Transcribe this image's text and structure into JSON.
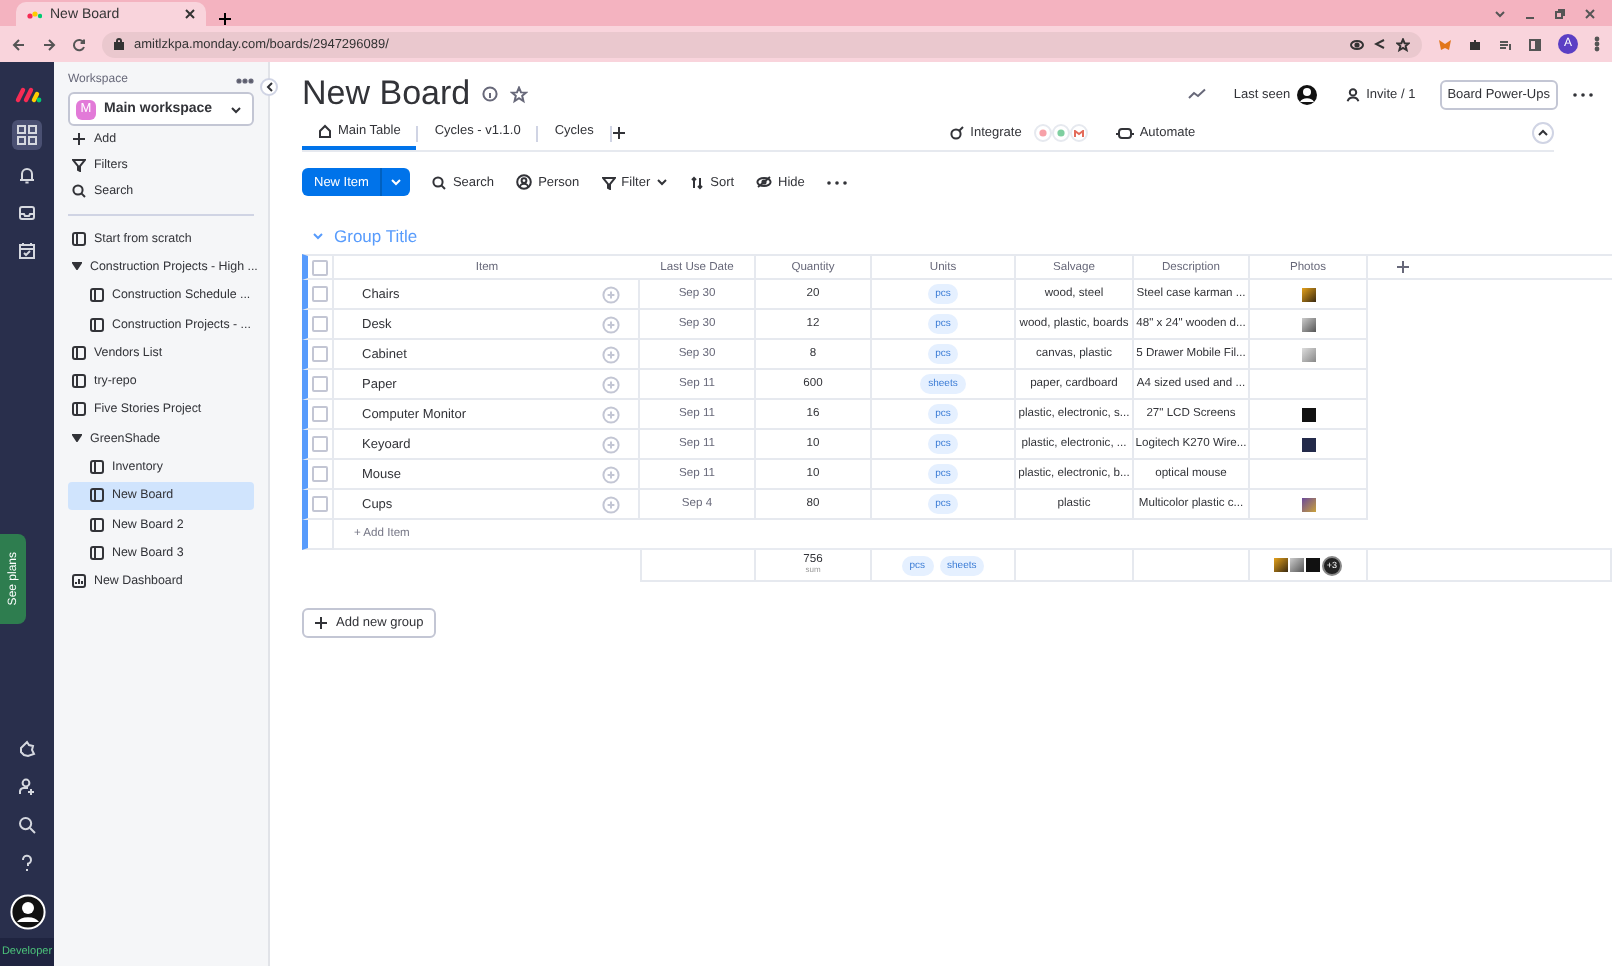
{
  "browser": {
    "tab_title": "New Board",
    "url": "amitlzkpa.monday.com/boards/2947296089/",
    "profile_initial": "A"
  },
  "rail": {
    "see_plans": "See plans",
    "developer": "Developer"
  },
  "sidebar": {
    "label": "Workspace",
    "workspace": {
      "initial": "M",
      "name": "Main workspace"
    },
    "actions": [
      "Add",
      "Filters",
      "Search"
    ],
    "items": [
      {
        "kind": "board",
        "label": "Start from scratch",
        "selected": false
      },
      {
        "kind": "folder",
        "label": "Construction Projects - High ...",
        "expanded": true,
        "children": [
          {
            "kind": "board",
            "label": "Construction Schedule ...",
            "selected": false
          },
          {
            "kind": "board",
            "label": "Construction Projects - ...",
            "selected": false
          }
        ]
      },
      {
        "kind": "board",
        "label": "Vendors List",
        "selected": false
      },
      {
        "kind": "board",
        "label": "try-repo",
        "selected": false
      },
      {
        "kind": "board",
        "label": "Five Stories Project",
        "selected": false
      },
      {
        "kind": "folder",
        "label": "GreenShade",
        "expanded": true,
        "children": [
          {
            "kind": "board",
            "label": "Inventory",
            "selected": false
          },
          {
            "kind": "board",
            "label": "New Board",
            "selected": true
          },
          {
            "kind": "board",
            "label": "New Board 2",
            "selected": false
          },
          {
            "kind": "board",
            "label": "New Board 3",
            "selected": false
          }
        ]
      },
      {
        "kind": "dashboard",
        "label": "New Dashboard",
        "selected": false
      }
    ]
  },
  "board": {
    "title": "New Board",
    "last_seen": "Last seen",
    "invite": "Invite / 1",
    "power_ups": "Board Power-Ups",
    "views": [
      {
        "label": "Main Table",
        "selected": true
      },
      {
        "label": "Cycles - v1.1.0",
        "selected": false
      },
      {
        "label": "Cycles",
        "selected": false
      }
    ],
    "integrate": "Integrate",
    "automate": "Automate",
    "toolbar": {
      "new_item": "New Item",
      "search": "Search",
      "person": "Person",
      "filter": "Filter",
      "sort": "Sort",
      "hide": "Hide"
    }
  },
  "group": {
    "title": "Group Title",
    "color": "#579bfc",
    "select_all_checked": false,
    "columns": [
      "Item",
      "Last Use Date",
      "Quantity",
      "Units",
      "Salvage",
      "Description",
      "Photos"
    ],
    "rows": [
      {
        "item": "Chairs",
        "date": "Sep 30",
        "quantity": "20",
        "units": "pcs",
        "salvage": "wood, steel",
        "description": "Steel case karman ...",
        "has_photo": true,
        "checked": false
      },
      {
        "item": "Desk",
        "date": "Sep 30",
        "quantity": "12",
        "units": "pcs",
        "salvage": "wood, plastic, boards",
        "description": "48\" x 24\" wooden d...",
        "has_photo": true,
        "checked": false
      },
      {
        "item": "Cabinet",
        "date": "Sep 30",
        "quantity": "8",
        "units": "pcs",
        "salvage": "canvas, plastic",
        "description": "5 Drawer Mobile Fil...",
        "has_photo": true,
        "checked": false
      },
      {
        "item": "Paper",
        "date": "Sep 11",
        "quantity": "600",
        "units": "sheets",
        "salvage": "paper, cardboard",
        "description": "A4 sized used and ...",
        "has_photo": false,
        "checked": false
      },
      {
        "item": "Computer Monitor",
        "date": "Sep 11",
        "quantity": "16",
        "units": "pcs",
        "salvage": "plastic, electronic, s...",
        "description": "27\" LCD Screens",
        "has_photo": true,
        "checked": false
      },
      {
        "item": "Keyoard",
        "date": "Sep 11",
        "quantity": "10",
        "units": "pcs",
        "salvage": "plastic, electronic, ...",
        "description": "Logitech K270 Wire...",
        "has_photo": true,
        "checked": false
      },
      {
        "item": "Mouse",
        "date": "Sep 11",
        "quantity": "10",
        "units": "pcs",
        "salvage": "plastic, electronic, b...",
        "description": "optical mouse",
        "has_photo": false,
        "checked": false
      },
      {
        "item": "Cups",
        "date": "Sep 4",
        "quantity": "80",
        "units": "pcs",
        "salvage": "plastic",
        "description": "Multicolor plastic c...",
        "has_photo": true,
        "checked": false
      }
    ],
    "add_item": "+ Add Item",
    "summary": {
      "quantity": "756",
      "quantity_label": "sum",
      "units": [
        "pcs",
        "sheets"
      ],
      "more_photos": "+3"
    }
  },
  "add_group": "Add new group"
}
